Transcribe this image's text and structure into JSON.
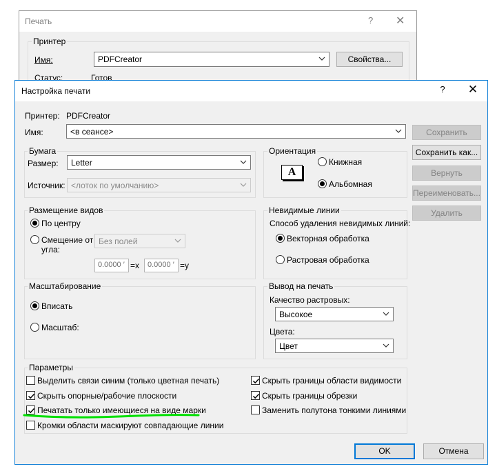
{
  "background_dialog": {
    "title": "Печать",
    "help": "?",
    "close": "✕",
    "printer_group": "Принтер",
    "name_label": "Имя:",
    "name_value": "PDFCreator",
    "properties_button": "Свойства...",
    "status_label": "Статус:",
    "status_value": "Готов"
  },
  "dialog": {
    "title": "Настройка печати",
    "help": "?",
    "close": "✕"
  },
  "printer": {
    "label": "Принтер:",
    "value": "PDFCreator"
  },
  "name": {
    "label": "Имя:",
    "value": "<в сеансе>"
  },
  "paper": {
    "group": "Бумага",
    "size_label": "Размер:",
    "size_value": "Letter",
    "source_label": "Источник:",
    "source_value": "<лоток по умолчанию>"
  },
  "orientation": {
    "group": "Ориентация",
    "preview_letter": "A",
    "portrait": "Книжная",
    "landscape": "Альбомная",
    "selected": "landscape"
  },
  "placement": {
    "group": "Размещение видов",
    "center": "По центру",
    "offset": "Смещение от угла:",
    "offset_line1": "Смещение от",
    "offset_line2": "угла:",
    "offset_select": "Без полей",
    "x_value": "0.0000 ′",
    "x_label": "=x",
    "y_value": "0.0000 ′",
    "y_label": "=y",
    "selected": "center"
  },
  "hidden_lines": {
    "group": "Невидимые линии",
    "method_label": "Способ удаления невидимых линий:",
    "vector": "Векторная обработка",
    "raster": "Растровая обработка",
    "selected": "vector"
  },
  "scaling": {
    "group": "Масштабирование",
    "fit": "Вписать",
    "zoom": "Масштаб:",
    "selected": "fit"
  },
  "output": {
    "group": "Вывод на печать",
    "quality_label": "Качество растровых:",
    "quality_value": "Высокое",
    "colors_label": "Цвета:",
    "colors_value": "Цвет"
  },
  "options": {
    "group": "Параметры",
    "items": [
      {
        "label": "Выделить связи синим (только цветная печать)",
        "checked": false
      },
      {
        "label": "Скрыть опорные/рабочие плоскости",
        "checked": true
      },
      {
        "label": "Печатать только имеющиеся на виде марки",
        "checked": true
      },
      {
        "label": "Кромки области маскируют совпадающие линии",
        "checked": false
      },
      {
        "label": "Скрыть границы области видимости",
        "checked": true
      },
      {
        "label": "Скрыть границы обрезки",
        "checked": true
      },
      {
        "label": "Заменить полутона тонкими линиями",
        "checked": false
      }
    ]
  },
  "side_buttons": {
    "save": "Сохранить",
    "save_as": "Сохранить как...",
    "revert": "Вернуть",
    "rename": "Переименовать...",
    "delete": "Удалить"
  },
  "footer": {
    "ok": "OK",
    "cancel": "Отмена"
  },
  "colors": {
    "accent": "#0078d7",
    "highlight_stroke": "#00e000",
    "dialog_bg": "#f0f0f0"
  }
}
